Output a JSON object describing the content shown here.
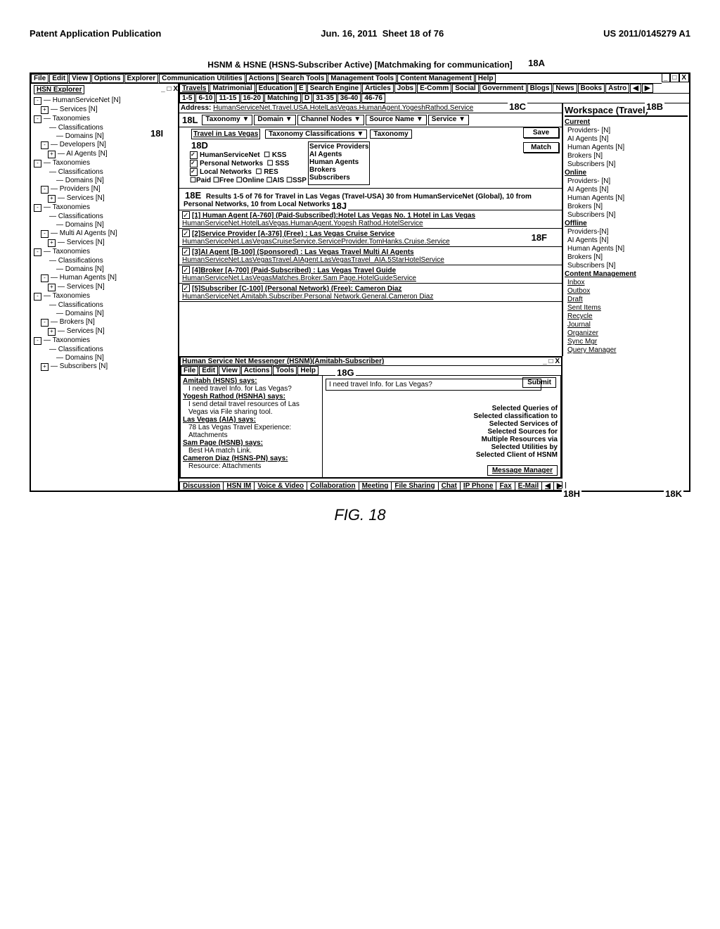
{
  "publication": {
    "left": "Patent Application Publication",
    "mid": "Jun. 16, 2011  Sheet 18 of 76",
    "right": "US 2011/0145279 A1"
  },
  "sheet_title": "HSNM & HSNE (HSNS-Subscriber Active) [Matchmaking for communication]",
  "figure_caption": "FIG. 18",
  "callouts": {
    "c18A": "18A",
    "c18B": "18B",
    "c18C": "18C",
    "c18D": "18D",
    "c18E": "18E",
    "c18F": "18F",
    "c18G": "18G",
    "c18H": "18H",
    "c18I": "18I",
    "c18J": "18J",
    "c18K": "18K",
    "c18L": "18L"
  },
  "menubar": [
    "File",
    "Edit",
    "View",
    "Options",
    "Explorer",
    "Communication Utilities",
    "Actions",
    "Search Tools",
    "Management Tools",
    "Content Management",
    "Help"
  ],
  "tabbar": [
    "Travels",
    "Matrimonial",
    "Education",
    "E",
    "Search Engine",
    "Articles",
    "Jobs",
    "E-Comm",
    "Social",
    "Government",
    "Blogs",
    "News",
    "Books",
    "Astro",
    "◀",
    "▶"
  ],
  "pager": [
    "1-5",
    "6-10",
    "11-15",
    "16-20",
    "Matching",
    "D",
    "31-35",
    "36-40",
    "46-76"
  ],
  "explorer": {
    "title": "HSN Explorer",
    "tree": [
      {
        "label": "HumanServiceNet [N]",
        "box": "-",
        "children": [
          {
            "label": "Services [N]",
            "box": "+"
          }
        ]
      },
      {
        "label": "Taxonomies",
        "box": "-",
        "children": [
          {
            "label": "Classifications",
            "children": [
              {
                "label": "Domains [N]"
              }
            ]
          },
          {
            "label": "Developers [N]",
            "box": "-",
            "children": [
              {
                "label": "AI Agents [N]",
                "box": "+"
              }
            ]
          }
        ]
      },
      {
        "label": "Taxonomies",
        "box": "-",
        "children": [
          {
            "label": "Classifications",
            "children": [
              {
                "label": "Domains [N]"
              }
            ]
          },
          {
            "label": "Providers [N]",
            "box": "-",
            "children": [
              {
                "label": "Services [N]",
                "box": "+"
              }
            ]
          }
        ]
      },
      {
        "label": "Taxonomies",
        "box": "-",
        "children": [
          {
            "label": "Classifications",
            "children": [
              {
                "label": "Domains [N]"
              }
            ]
          },
          {
            "label": "Multi AI Agents [N]",
            "box": "-",
            "children": [
              {
                "label": "Services [N]",
                "box": "+"
              }
            ]
          }
        ]
      },
      {
        "label": "Taxonomies",
        "box": "-",
        "children": [
          {
            "label": "Classifications",
            "children": [
              {
                "label": "Domains [N]"
              }
            ]
          },
          {
            "label": "Human Agents [N]",
            "box": "-",
            "children": [
              {
                "label": "Services [N]",
                "box": "+"
              }
            ]
          }
        ]
      },
      {
        "label": "Taxonomies",
        "box": "-",
        "children": [
          {
            "label": "Classifications",
            "children": [
              {
                "label": "Domains [N]"
              }
            ]
          },
          {
            "label": "Brokers [N]",
            "box": "-",
            "children": [
              {
                "label": "Services [N]",
                "box": "+"
              }
            ]
          }
        ]
      },
      {
        "label": "Taxonomies",
        "box": "-",
        "children": [
          {
            "label": "Classifications",
            "children": [
              {
                "label": "Domains [N]"
              }
            ]
          },
          {
            "label": "Subscribers [N]",
            "box": "+"
          }
        ]
      }
    ]
  },
  "address": {
    "label": "Address:",
    "value": "HumanServiceNet.Travel.USA.HotelLasVegas.HumanAgent.YogeshRathod.Service"
  },
  "selectors": [
    "Taxonomy ▼",
    "Domain ▼",
    "Channel Nodes ▼",
    "Source Name ▼",
    "Service ▼"
  ],
  "travel_header": "Travel in Las Vegas",
  "travel_sel": [
    "Taxonomy Classifications ▼",
    "Taxonomy"
  ],
  "check_networks": [
    {
      "label": "HumanServiceNet",
      "on": true,
      "right": "KSS"
    },
    {
      "label": "Personal Networks",
      "on": true,
      "right": "SSS"
    },
    {
      "label": "Local Networks",
      "on": true,
      "right": "RES"
    }
  ],
  "check_pay": "☐Paid ☐Free ☐Online ☐AIS ☐SSP",
  "provider_list": [
    "Service Providers",
    "AI Agents",
    "Human Agents",
    "Brokers",
    "Subscribers"
  ],
  "buttons": {
    "save": "Save",
    "match": "Match",
    "submit": "Submit"
  },
  "result_note": "Results 1-5 of 76 for Travel in Las Vegas (Travel-USA) 30 from HumanServiceNet (Global), 10 from Personal Networks, 10 from Local Networks",
  "results": [
    {
      "line1": "[1] Human Agent [A-760] (Paid-Subscribed):Hotel Las Vegas No. 1 Hotel in Las Vegas",
      "line2": "HumanServiceNet.HotelLasVegas.HumanAgent.Yogesh Rathod.HotelService"
    },
    {
      "line1": "[2]Service Provider [A-376] (Free) : Las Vegas Cruise Service",
      "line2": "HumanServiceNet.LasVegasCruiseService.ServiceProvider.TomHanks.Cruise.Service"
    },
    {
      "line1": "[3]AI Agent [B-100] (Sponsored) : Las Vegas Travel Multi AI Agents",
      "line2": "HumanServiceNet.LasVegasTravel.AIAgent.LasVegasTravel_AIA.5StarHotelService"
    },
    {
      "line1": "[4]Broker [A-700] (Paid-Subscribed) : Las Vegas Travel Guide",
      "line2": "HumanServiceNet.LasVegasMatches.Broker.Sam Page.HotelGuideService"
    },
    {
      "line1": "[5]Subscriber [C-100] (Personal Network) (Free): Cameron Diaz",
      "line2": "HumanServiceNet.Amitabh.Subscriber.Personal Network.General.Cameron Diaz"
    }
  ],
  "workspace": {
    "title": "Workspace (Travel)",
    "sections": [
      {
        "head": "Current",
        "items": [
          "Providers- [N]",
          "AI Agents [N]",
          "Human Agents [N]",
          "Brokers [N]",
          "Subscribers [N]"
        ]
      },
      {
        "head": "Online",
        "items": [
          "Providers- [N]",
          "AI Agents [N]",
          "Human Agents [N]",
          "Brokers [N]",
          "Subscribers [N]"
        ]
      },
      {
        "head": "Offline",
        "items": [
          "Providers-[N]",
          "AI Agents [N]",
          "Human Agents [N]",
          "Brokers [N]",
          "Subscribers [N]"
        ]
      }
    ],
    "content_mgmt": "Content Management",
    "links": [
      "Inbox",
      "Outbox",
      "Draft",
      "Sent Items",
      "Recycle",
      "Journal",
      "Organizer",
      "Sync Mgr",
      "Query Manager"
    ]
  },
  "messenger": {
    "title": "Human Service Net Messenger (HSNM)(Amitabh-Subscriber)",
    "menu": [
      "File",
      "Edit",
      "View",
      "Actions",
      "Tools",
      "Help"
    ],
    "chat": [
      {
        "name": "Amitabh (HSNS) says:",
        "msg": "I need travel Info. for Las Vegas?"
      },
      {
        "name": "Yogesh Rathod (HSNHA) says:",
        "msg": "I send detail travel resources of Las Vegas via File sharing tool."
      },
      {
        "name": "Las Vegas (AIA) says:",
        "msg": "78 Las Vegas Travel Experience: Attachments"
      },
      {
        "name": "Sam Page (HSNB) says:",
        "msg": "Best HA match Link."
      },
      {
        "name": "Cameron Diaz (HSNS-PN) says:",
        "msg": "Resource: Attachments"
      }
    ],
    "input": "I need travel Info. for Las Vegas?",
    "right_list": [
      "Selected Queries of",
      "Selected classification to",
      "Selected Services of",
      "Selected Sources for",
      "Multiple Resources via",
      "Selected Utilities by",
      "Selected Client of HSNM"
    ],
    "msg_mgr": "Message Manager",
    "bottom": [
      "Discussion",
      "HSN IM",
      "Voice & Video",
      "Collaboration",
      "Meeting",
      "File Sharing",
      "Chat",
      "IP Phone",
      "Fax",
      "E-Mail",
      "◀",
      "▶"
    ]
  }
}
